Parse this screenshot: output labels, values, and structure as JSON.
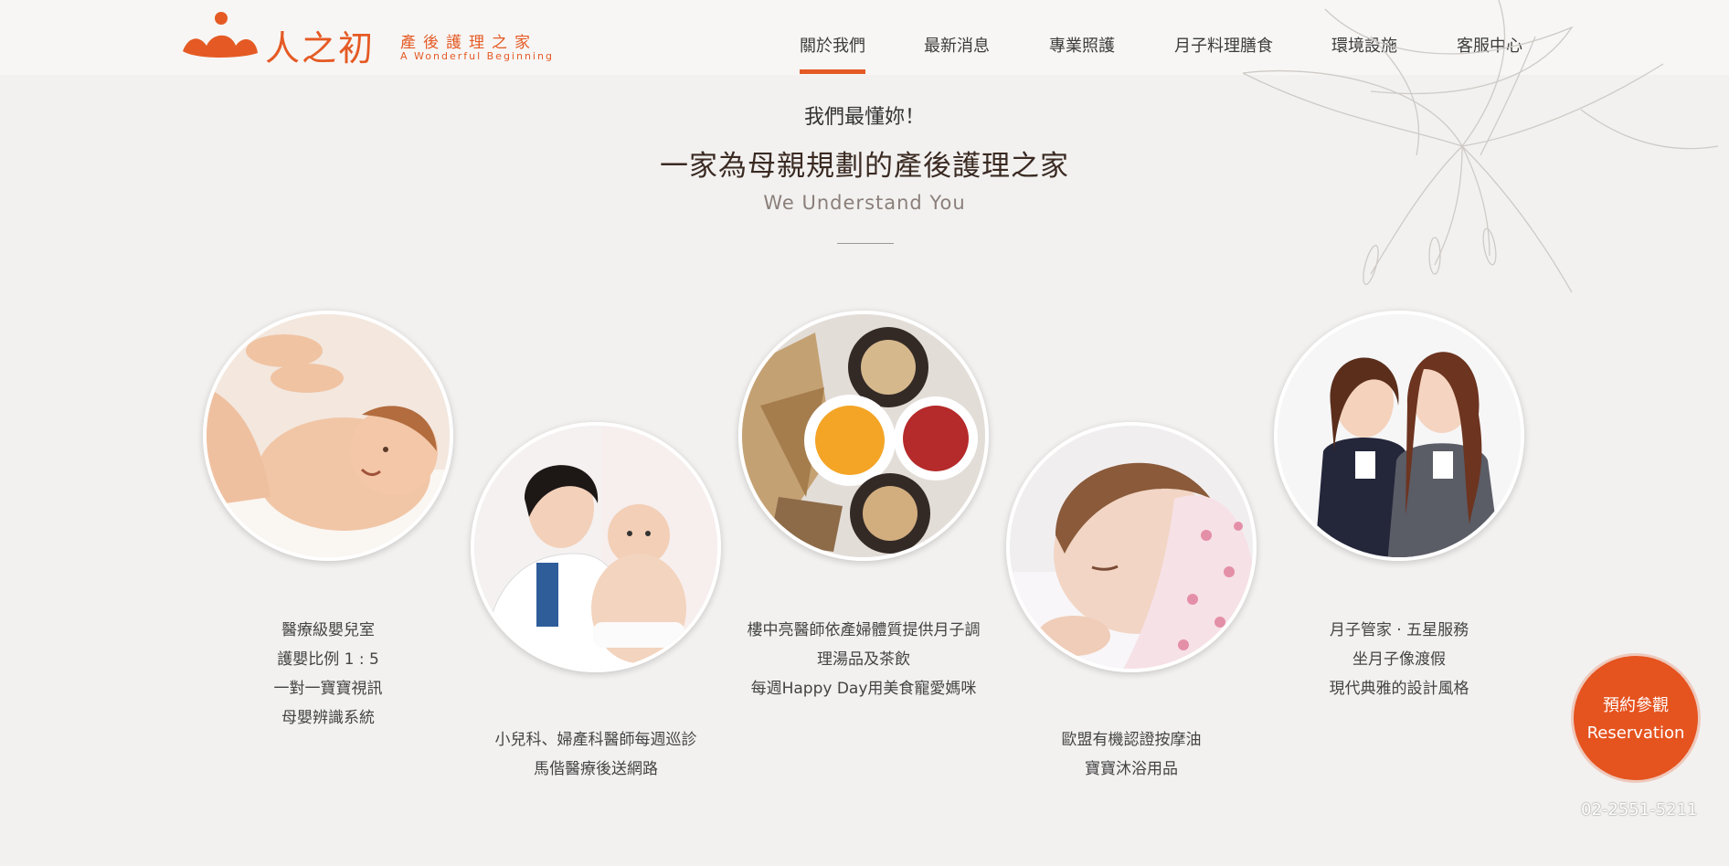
{
  "header": {
    "logo_cn": "人之初",
    "logo_sub": "產後護理之家",
    "logo_en": "A Wonderful Beginning"
  },
  "nav": [
    {
      "label": "關於我們",
      "active": true
    },
    {
      "label": "最新消息"
    },
    {
      "label": "專業照護"
    },
    {
      "label": "月子料理膳食"
    },
    {
      "label": "環境設施"
    },
    {
      "label": "客服中心"
    }
  ],
  "intro": {
    "tagline": "我們最懂妳！",
    "headline": "一家為母親規劃的產後護理之家",
    "subline": "We Understand You"
  },
  "features": [
    {
      "image": "baby-massage-photo",
      "lines": [
        "醫療級嬰兒室",
        "護嬰比例 1 : 5",
        "一對一寶寶視訊",
        "母嬰辨識系統"
      ]
    },
    {
      "image": "doctor-with-baby-photo",
      "lines": [
        "小兒科、婦產科醫師每週巡診",
        "馬偕醫療後送網路"
      ]
    },
    {
      "image": "herbal-ingredients-photo",
      "lines": [
        "樓中亮醫師依產婦體質提供月子調",
        "理湯品及茶飲",
        "每週Happy Day用美食寵愛媽咪"
      ]
    },
    {
      "image": "sleeping-baby-photo",
      "lines": [
        "歐盟有機認證按摩油",
        "寶寶沐浴用品"
      ]
    },
    {
      "image": "staff-photo",
      "lines": [
        "月子管家 · 五星服務",
        "坐月子像渡假",
        "現代典雅的設計風格"
      ]
    }
  ],
  "reservation": {
    "line1": "預約參觀",
    "line2": "Reservation"
  },
  "phone": "02-2551-5211",
  "colors": {
    "accent": "#e55a24",
    "background": "#f2f1f0"
  }
}
